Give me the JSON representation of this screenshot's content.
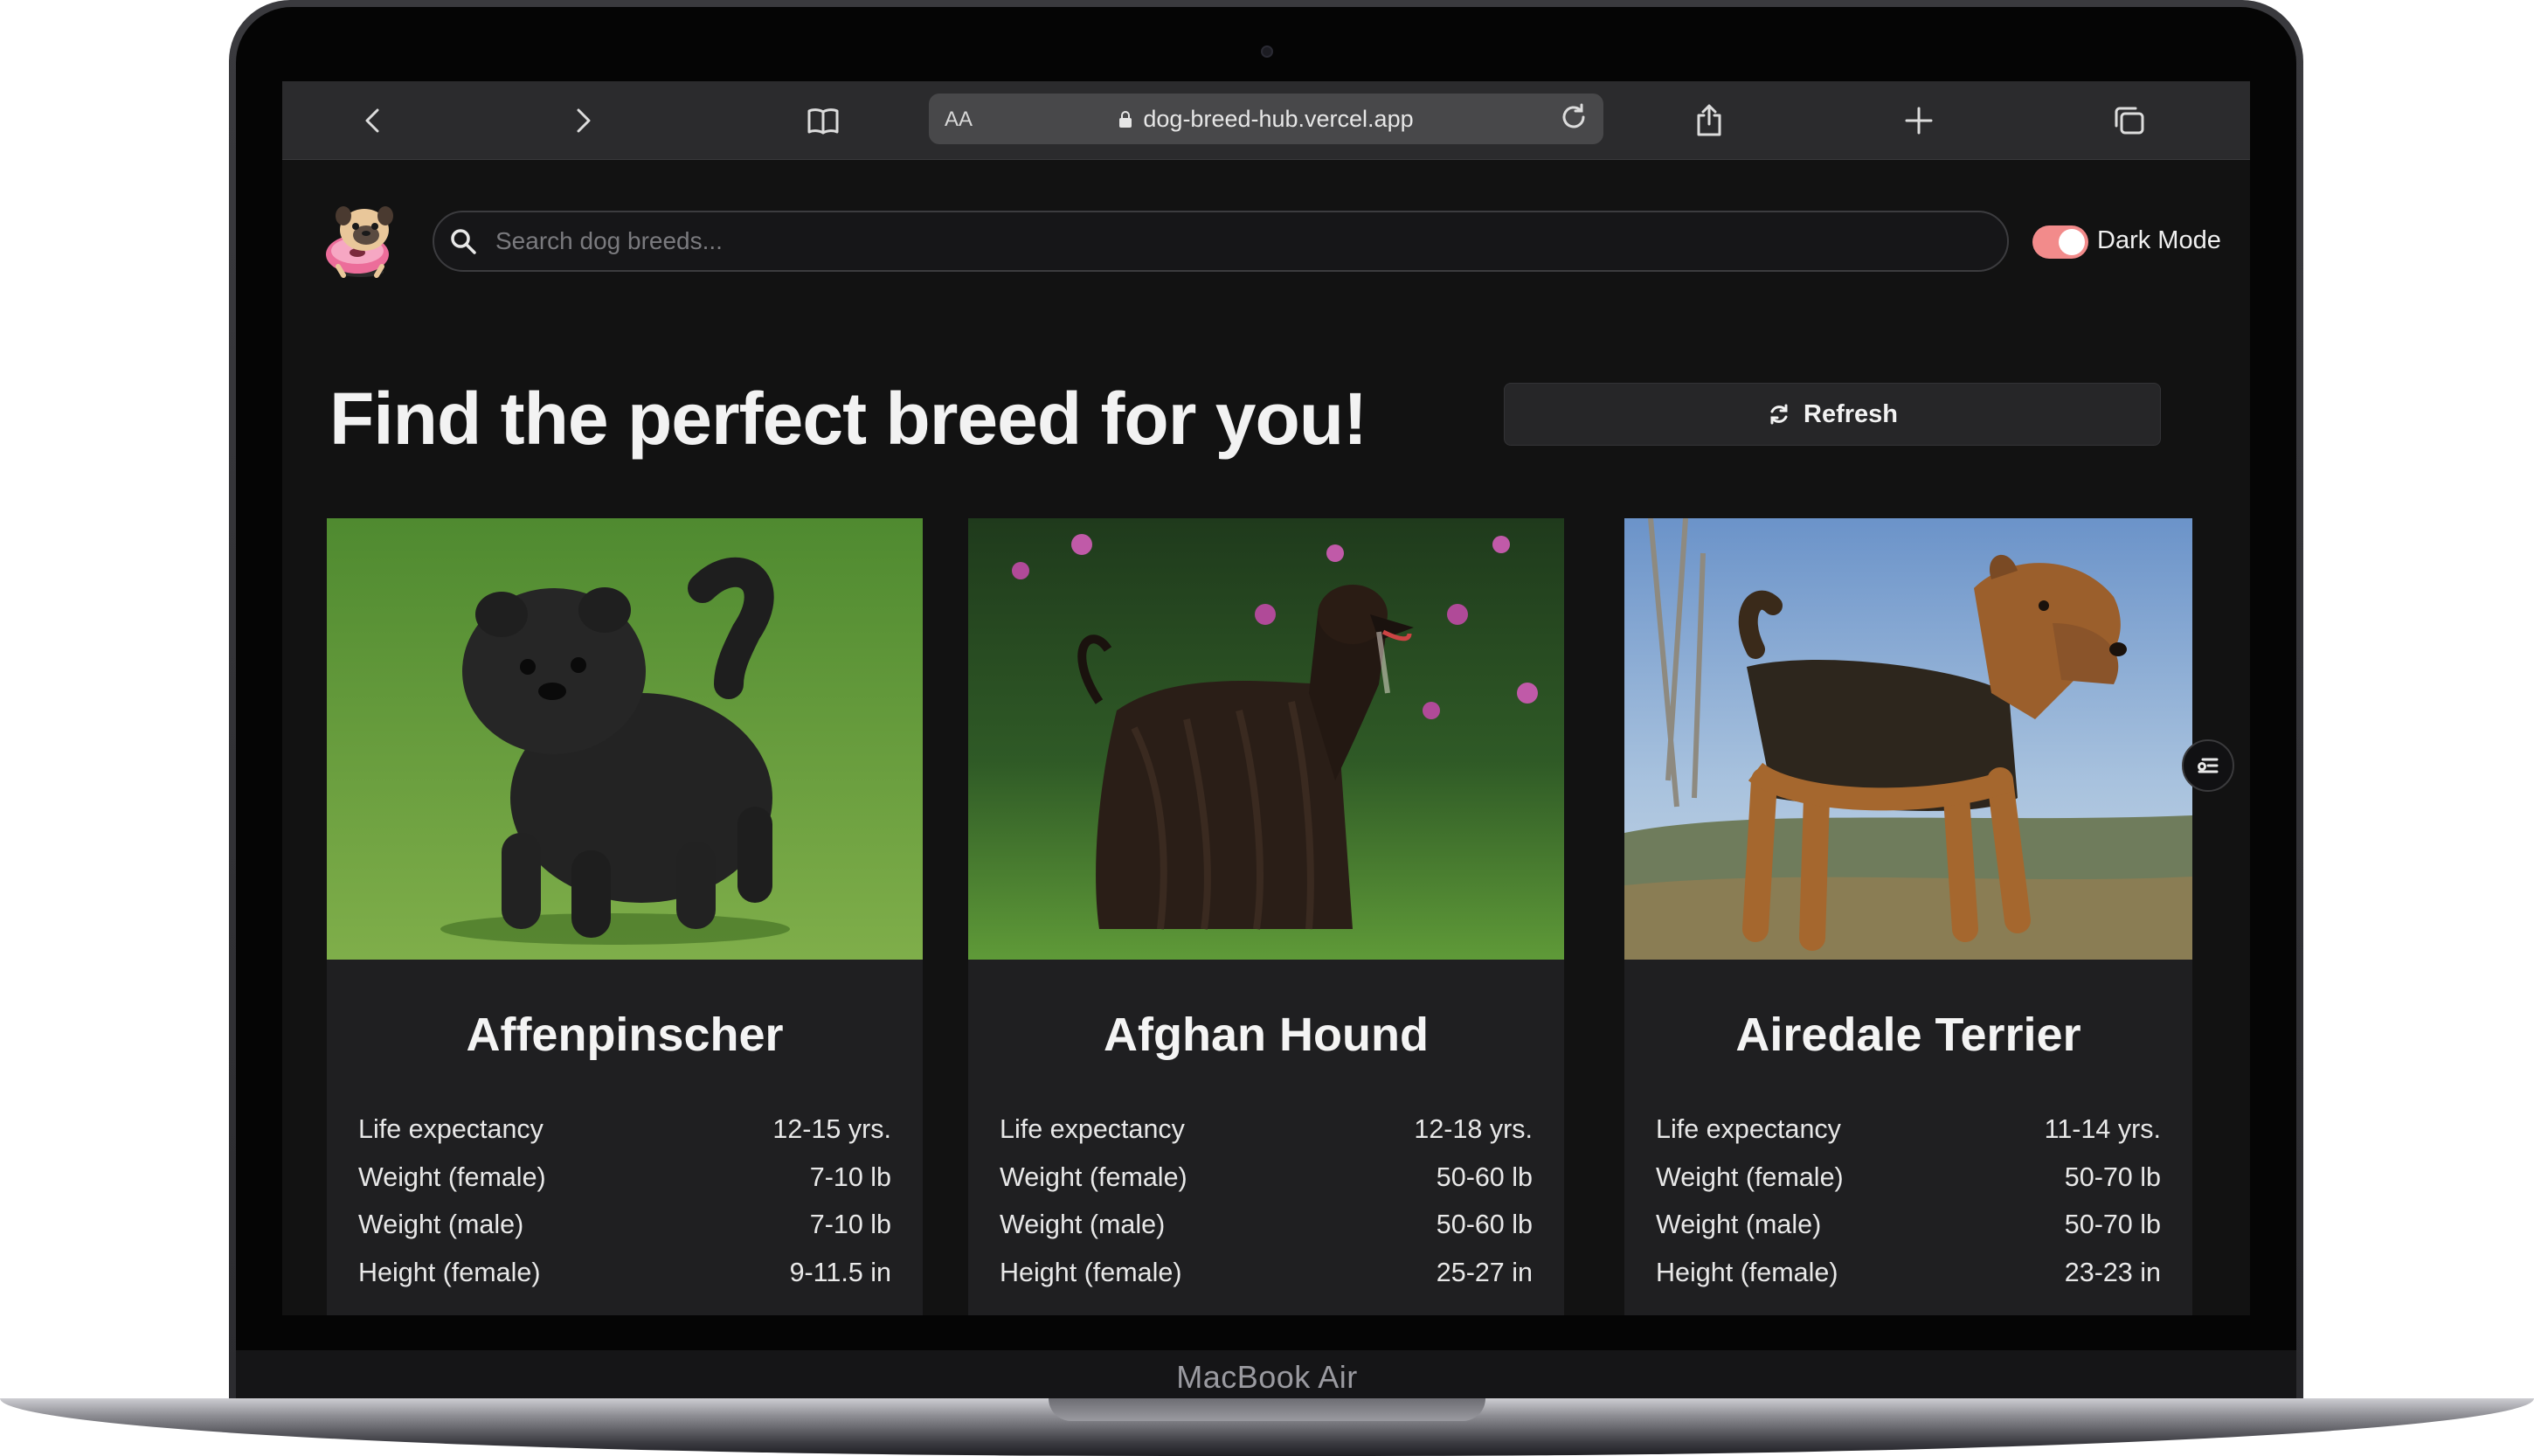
{
  "device": {
    "label": "MacBook Air"
  },
  "browser": {
    "text_size_label": "AA",
    "url": "dog-breed-hub.vercel.app",
    "icons": [
      "back-icon",
      "forward-icon",
      "bookmarks-icon",
      "lock-icon",
      "reload-icon",
      "share-icon",
      "new-tab-icon",
      "tabs-overview-icon"
    ]
  },
  "header": {
    "search_placeholder": "Search dog breeds...",
    "search_value": "",
    "dark_mode_label": "Dark Mode",
    "dark_mode_on": true,
    "toggle_color": "#f28b8b"
  },
  "hero": {
    "title": "Find the perfect breed for you!",
    "refresh_label": "Refresh"
  },
  "breeds": [
    {
      "name": "Affenpinscher",
      "stats": [
        {
          "label": "Life expectancy",
          "value": "12-15 yrs."
        },
        {
          "label": "Weight (female)",
          "value": "7-10 lb"
        },
        {
          "label": "Weight (male)",
          "value": "7-10 lb"
        },
        {
          "label": "Height (female)",
          "value": "9-11.5 in"
        }
      ]
    },
    {
      "name": "Afghan Hound",
      "stats": [
        {
          "label": "Life expectancy",
          "value": "12-18 yrs."
        },
        {
          "label": "Weight (female)",
          "value": "50-60 lb"
        },
        {
          "label": "Weight (male)",
          "value": "50-60 lb"
        },
        {
          "label": "Height (female)",
          "value": "25-27 in"
        }
      ]
    },
    {
      "name": "Airedale Terrier",
      "stats": [
        {
          "label": "Life expectancy",
          "value": "11-14 yrs."
        },
        {
          "label": "Weight (female)",
          "value": "50-70 lb"
        },
        {
          "label": "Weight (male)",
          "value": "50-70 lb"
        },
        {
          "label": "Height (female)",
          "value": "23-23 in"
        }
      ]
    }
  ],
  "colors": {
    "page_bg": "#121212",
    "card_bg": "#1f1f21",
    "toolbar_bg": "#2b2b2d"
  }
}
